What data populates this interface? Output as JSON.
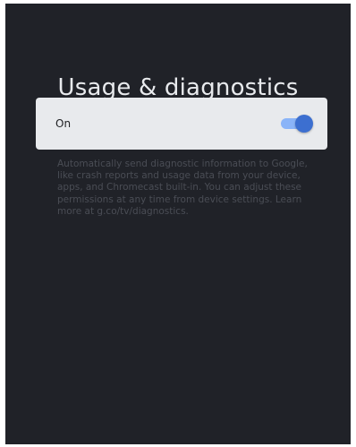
{
  "header": {
    "title": "Usage & diagnostics"
  },
  "setting": {
    "label": "On",
    "toggle_state": "on",
    "toggle_icon": "toggle-switch-icon",
    "colors": {
      "track": "#8ab4f8",
      "thumb": "#3c6fd0"
    }
  },
  "description": {
    "text": "Automatically send diagnostic information to Google, like crash reports and usage data from your device, apps, and Chromecast built-in. You can adjust these permissions at any time from device settings. Learn more at g.co/tv/diagnostics."
  },
  "colors": {
    "background": "#202228",
    "title": "#e8eaed",
    "row": "#e8eaed"
  }
}
